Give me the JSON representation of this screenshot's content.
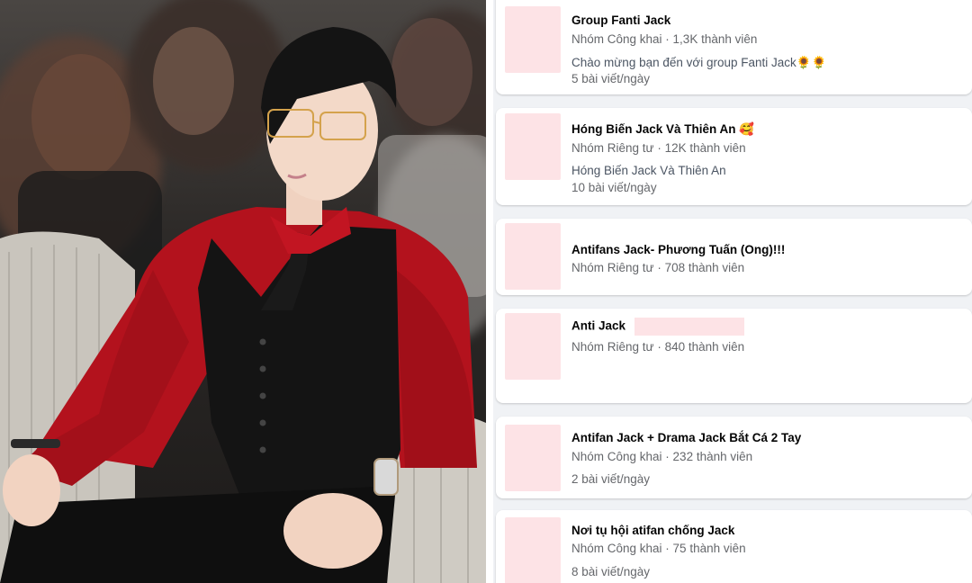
{
  "groups": [
    {
      "name": "Group Fanti Jack",
      "meta": "Nhóm Công khai · 1,3K thành viên",
      "desc": "Chào mừng bạn đến với group Fanti Jack🌻🌻",
      "posts": "5 bài viết/ngày"
    },
    {
      "name": "Hóng Biến Jack Và Thiên An 🥰",
      "meta": "Nhóm Riêng tư · 12K thành viên",
      "desc": "Hóng Biến Jack Và Thiên An",
      "posts": "10 bài viết/ngày"
    },
    {
      "name": "Antifans Jack- Phương Tuấn (Ong)!!!",
      "meta": "Nhóm Riêng tư · 708 thành viên"
    },
    {
      "name": "Anti Jack",
      "meta": "Nhóm Riêng tư · 840 thành viên"
    },
    {
      "name": "Antifan Jack + Drama Jack Bắt Cá 2 Tay",
      "meta": "Nhóm Công khai · 232 thành viên",
      "posts": "2 bài viết/ngày"
    },
    {
      "name": "Nơi tụ hội atifan chống Jack",
      "meta": "Nhóm Công khai · 75 thành viên",
      "posts": "8 bài viết/ngày"
    }
  ],
  "colors": {
    "card_bg": "#ffffff",
    "list_bg": "#f0f2f5",
    "thumb_placeholder": "#fde3e6",
    "shirt": "#b3121d",
    "vest": "#141414"
  }
}
